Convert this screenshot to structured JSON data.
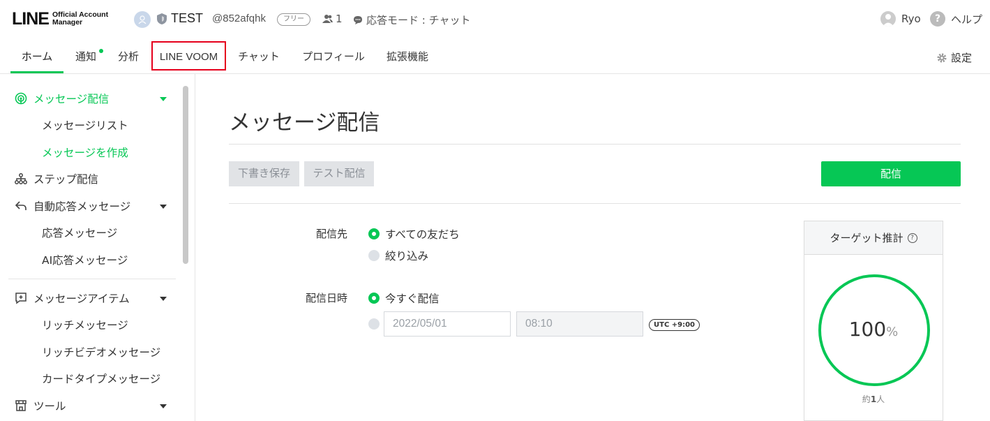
{
  "header": {
    "logo_main": "LINE",
    "logo_sub_line1": "Official Account",
    "logo_sub_line2": "Manager",
    "account_name": "TEST",
    "account_id": "@852afqhk",
    "plan": "フリー",
    "friends_count": "1",
    "mode": "応答モード : チャット",
    "user_name": "Ryo",
    "help": "ヘルプ"
  },
  "nav": {
    "tabs": [
      {
        "label": "ホーム",
        "active": true
      },
      {
        "label": "通知",
        "has_dot": true
      },
      {
        "label": "分析"
      },
      {
        "label": "LINE VOOM",
        "highlighted": true
      },
      {
        "label": "チャット"
      },
      {
        "label": "プロフィール"
      },
      {
        "label": "拡張機能"
      }
    ],
    "settings": "設定"
  },
  "sidebar": {
    "sections": [
      {
        "label": "メッセージ配信",
        "icon": "broadcast-icon",
        "active": true,
        "children": [
          "メッセージリスト",
          "メッセージを作成"
        ],
        "active_child": "メッセージを作成"
      },
      {
        "label": "ステップ配信",
        "icon": "step-icon"
      },
      {
        "label": "自動応答メッセージ",
        "icon": "reply-icon",
        "children": [
          "応答メッセージ",
          "AI応答メッセージ"
        ]
      },
      {
        "label": "メッセージアイテム",
        "icon": "message-plus-icon",
        "children": [
          "リッチメッセージ",
          "リッチビデオメッセージ",
          "カードタイプメッセージ"
        ]
      },
      {
        "label": "ツール",
        "icon": "store-icon"
      }
    ]
  },
  "main": {
    "title": "メッセージ配信",
    "draft_button": "下書き保存",
    "test_button": "テスト配信",
    "send_button": "配信",
    "recipients_label": "配信先",
    "recipients_options": [
      "すべての友だち",
      "絞り込み"
    ],
    "datetime_label": "配信日時",
    "datetime_options": [
      "今すぐ配信"
    ],
    "date_placeholder": "2022/05/01",
    "time_placeholder": "08:10",
    "timezone": "UTC +9:00"
  },
  "target": {
    "title": "ターゲット推計",
    "percent": "100",
    "percent_unit": "%",
    "estimate_prefix": "約",
    "estimate_value": "1",
    "estimate_unit": "人"
  },
  "colors": {
    "accent": "#06c755",
    "highlight_border": "#e5001c"
  }
}
